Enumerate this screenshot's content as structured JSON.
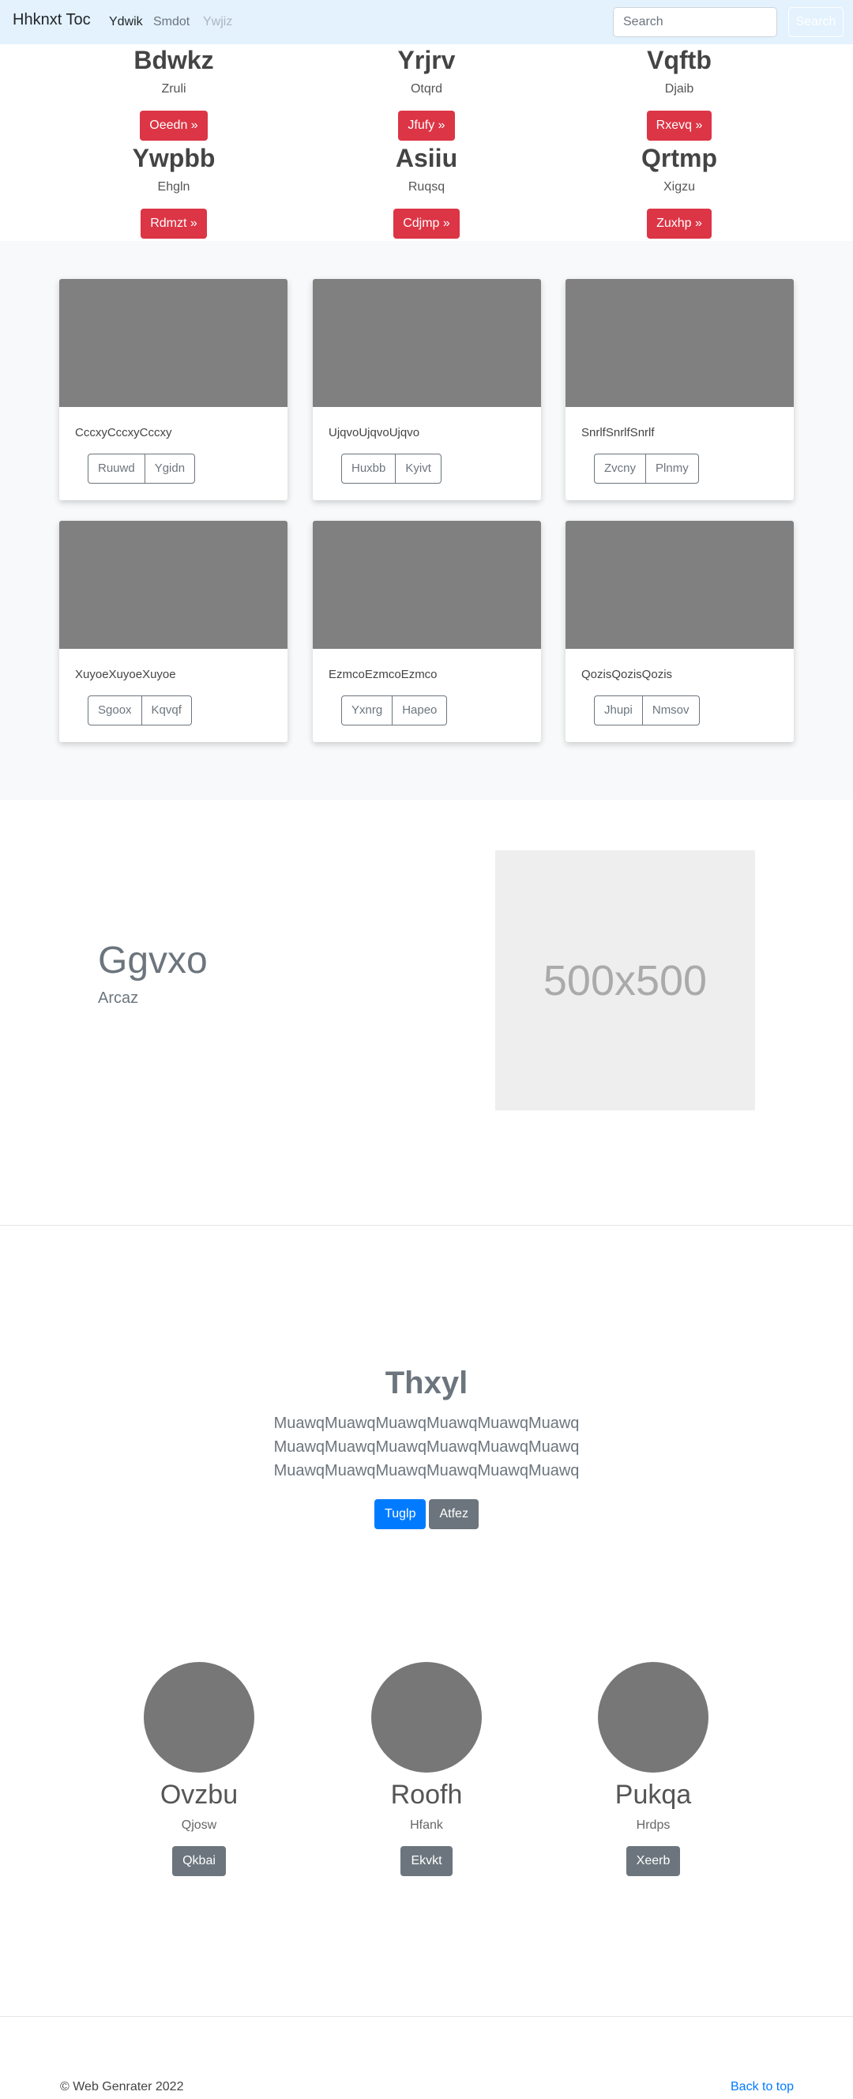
{
  "navbar": {
    "brand": "Hhknxt Toc",
    "links": [
      "Ydwik",
      "Smdot",
      "Ywjiz"
    ],
    "search_placeholder": "Search",
    "search_button": "Search"
  },
  "features": [
    {
      "title": "Bdwkz",
      "subtitle": "Zruli",
      "button": "Oeedn »"
    },
    {
      "title": "Yrjrv",
      "subtitle": "Otqrd",
      "button": "Jfufy »"
    },
    {
      "title": "Vqftb",
      "subtitle": "Djaib",
      "button": "Rxevq »"
    },
    {
      "title": "Ywpbb",
      "subtitle": "Ehgln",
      "button": "Rdmzt »"
    },
    {
      "title": "Asiiu",
      "subtitle": "Ruqsq",
      "button": "Cdjmp »"
    },
    {
      "title": "Qrtmp",
      "subtitle": "Xigzu",
      "button": "Zuxhp »"
    }
  ],
  "album": {
    "cards": [
      {
        "text": "CccxyCccxyCccxy",
        "buttons": [
          "Ruuwd",
          "Ygidn"
        ]
      },
      {
        "text": "UjqvoUjqvoUjqvo",
        "buttons": [
          "Huxbb",
          "Kyivt"
        ]
      },
      {
        "text": "SnrlfSnrlfSnrlf",
        "buttons": [
          "Zvcny",
          "Plnmy"
        ]
      },
      {
        "text": "XuyoeXuyoeXuyoe",
        "buttons": [
          "Sgoox",
          "Kqvqf"
        ]
      },
      {
        "text": "EzmcoEzmcoEzmco",
        "buttons": [
          "Yxnrg",
          "Hapeo"
        ]
      },
      {
        "text": "QozisQozisQozis",
        "buttons": [
          "Jhupi",
          "Nmsov"
        ]
      }
    ]
  },
  "featurette": {
    "heading": "Ggvxo",
    "subheading": "Arcaz",
    "image_label": "500x500"
  },
  "jumbotron": {
    "title": "Thxyl",
    "lines": [
      "MuawqMuawqMuawqMuawqMuawqMuawq",
      "MuawqMuawqMuawqMuawqMuawqMuawq",
      "MuawqMuawqMuawqMuawqMuawqMuawq"
    ],
    "primary_button": "Tuglp",
    "secondary_button": "Atfez"
  },
  "team": [
    {
      "name": "Ovzbu",
      "role": "Qjosw",
      "button": "Qkbai"
    },
    {
      "name": "Roofh",
      "role": "Hfank",
      "button": "Ekvkt"
    },
    {
      "name": "Pukqa",
      "role": "Hrdps",
      "button": "Xeerb"
    }
  ],
  "footer": {
    "copyright": "© Web Genrater 2022",
    "back_to_top": "Back to top"
  },
  "colors": {
    "navbar_bg": "#e3f2fd",
    "danger": "#dc3545",
    "primary": "#007bff",
    "secondary": "#6c757d",
    "card_image": "#808080",
    "album_bg": "#f8f9fa"
  }
}
